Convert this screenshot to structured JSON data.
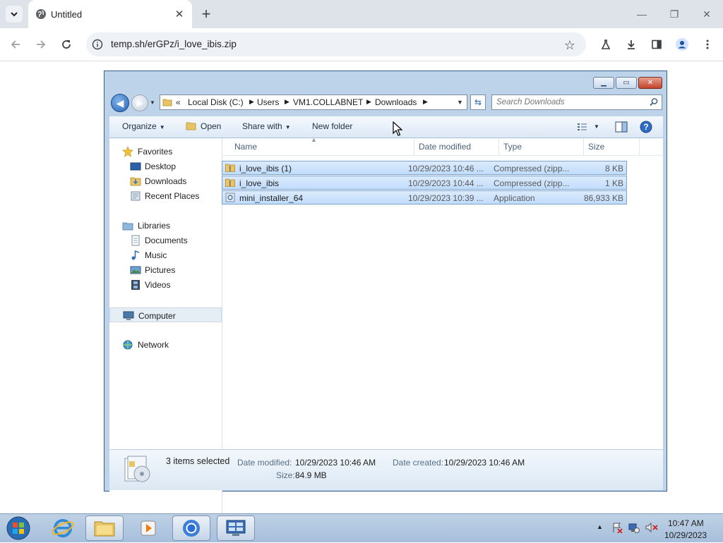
{
  "browser": {
    "tab_title": "Untitled",
    "url": "temp.sh/erGPz/i_love_ibis.zip"
  },
  "explorer": {
    "breadcrumb": {
      "overflow": "«",
      "items": [
        "Local Disk (C:)",
        "Users",
        "VM1.COLLABNET",
        "Downloads"
      ]
    },
    "search_placeholder": "Search Downloads",
    "command_bar": {
      "organize": "Organize",
      "open": "Open",
      "share_with": "Share with",
      "new_folder": "New folder"
    },
    "nav": {
      "favorites": "Favorites",
      "desktop": "Desktop",
      "downloads": "Downloads",
      "recent_places": "Recent Places",
      "libraries": "Libraries",
      "documents": "Documents",
      "music": "Music",
      "pictures": "Pictures",
      "videos": "Videos",
      "computer": "Computer",
      "network": "Network"
    },
    "columns": {
      "name": "Name",
      "date_modified": "Date modified",
      "type": "Type",
      "size": "Size"
    },
    "files": [
      {
        "name": "i_love_ibis (1)",
        "date": "10/29/2023 10:46 ...",
        "type": "Compressed (zipp...",
        "size": "8 KB",
        "icon": "zip-folder-icon"
      },
      {
        "name": "i_love_ibis",
        "date": "10/29/2023 10:44 ...",
        "type": "Compressed (zipp...",
        "size": "1 KB",
        "icon": "zip-folder-icon"
      },
      {
        "name": "mini_installer_64",
        "date": "10/29/2023 10:39 ...",
        "type": "Application",
        "size": "86,933 KB",
        "icon": "application-icon"
      }
    ],
    "details": {
      "selection": "3 items selected",
      "date_modified_label": "Date modified:",
      "date_modified": "10/29/2023 10:46 AM",
      "date_created_label": "Date created:",
      "date_created": "10/29/2023 10:46 AM",
      "size_label": "Size:",
      "size": "84.9 MB"
    }
  },
  "taskbar": {
    "time": "10:47 AM",
    "date": "10/29/2023"
  },
  "colors": {
    "selection_fill": "#cce3fc",
    "selection_border": "#7da2ce",
    "taskbar": "#b3c8e0",
    "chrome_frame": "#dee3ea"
  }
}
